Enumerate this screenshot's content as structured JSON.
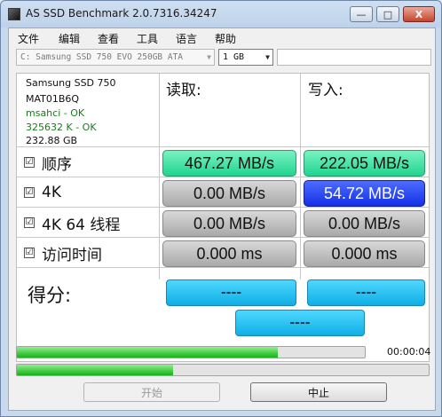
{
  "window": {
    "title": "AS SSD Benchmark 2.0.7316.34247",
    "minimize_glyph": "—",
    "maximize_glyph": "□",
    "close_glyph": "X"
  },
  "menu": [
    "文件",
    "编辑",
    "查看",
    "工具",
    "语言",
    "帮助"
  ],
  "toolbar": {
    "drive": "C: Samsung SSD 750 EVO 250GB ATA",
    "size": "1 GB",
    "dropdown_glyph": "▼"
  },
  "drive_info": {
    "model": "Samsung SSD 750",
    "firmware": "MAT01B6Q",
    "driver": "msahci - OK",
    "alignment": "325632 K - OK",
    "capacity": "232.88 GB"
  },
  "columns": {
    "read": "读取:",
    "write": "写入:"
  },
  "tests": [
    {
      "label": "顺序",
      "checked": "☑",
      "read": "467.27 MB/s",
      "write": "222.05 MB/s"
    },
    {
      "label": "4K",
      "checked": "☑",
      "read": "0.00 MB/s",
      "write": "54.72 MB/s"
    },
    {
      "label": "4K 64 线程",
      "checked": "☑",
      "read": "0.00 MB/s",
      "write": "0.00 MB/s"
    },
    {
      "label": "访问时间",
      "checked": "☑",
      "read": "0.000 ms",
      "write": "0.000 ms"
    }
  ],
  "score": {
    "label": "得分:",
    "read": "----",
    "write": "----",
    "total": "----"
  },
  "progress": {
    "overall_fraction": 0.75,
    "current_fraction": 0.38,
    "elapsed": "00:00:04"
  },
  "buttons": {
    "start": "开始",
    "abort": "中止"
  },
  "colors": {
    "sequential_green": "#20d48f",
    "active_blue": "#1330e6",
    "score_cyan": "#0eaee6"
  }
}
